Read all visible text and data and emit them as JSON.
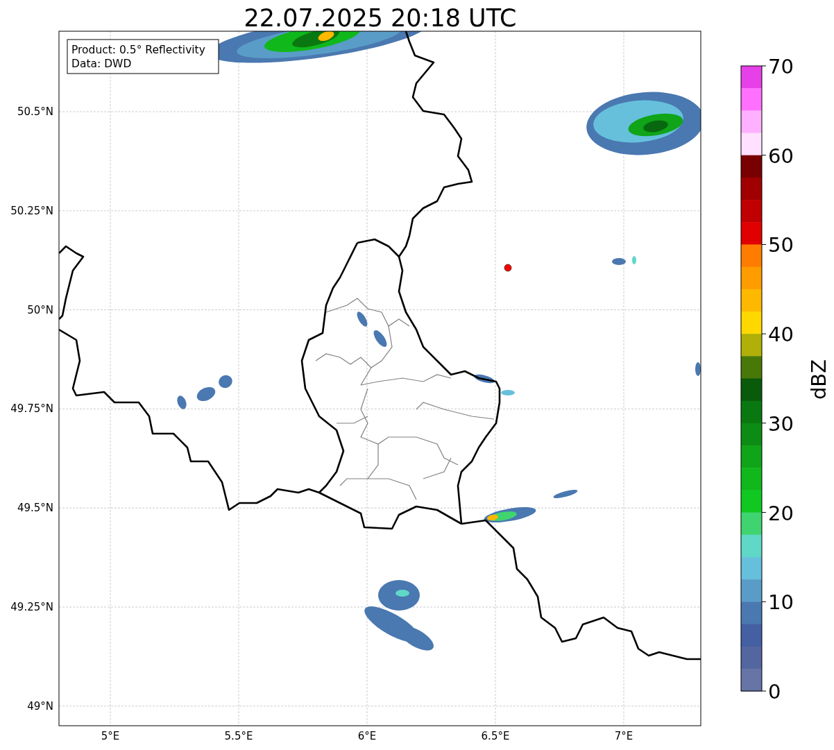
{
  "title": "22.07.2025 20:18 UTC",
  "map": {
    "info_box": [
      "Product: 0.5° Reflectivity",
      "Data: DWD"
    ],
    "lon_ticks": [
      "5°E",
      "5.5°E",
      "6°E",
      "6.5°E",
      "7°E"
    ],
    "lat_ticks": [
      "50.5°N",
      "50.25°N",
      "50°N",
      "49.75°N",
      "49.5°N",
      "49.25°N",
      "49°N"
    ]
  },
  "colorbar": {
    "label": "dBZ",
    "ticks": [
      "70",
      "60",
      "50",
      "40",
      "30",
      "20",
      "10",
      "0"
    ],
    "segments": [
      {
        "color": "#e840e8"
      },
      {
        "color": "#ff70ff"
      },
      {
        "color": "#ffb0ff"
      },
      {
        "color": "#ffe0ff"
      },
      {
        "color": "#780000"
      },
      {
        "color": "#a00000"
      },
      {
        "color": "#c00000"
      },
      {
        "color": "#e00000"
      },
      {
        "color": "#ff7c00"
      },
      {
        "color": "#ff9c00"
      },
      {
        "color": "#ffb800"
      },
      {
        "color": "#ffd800"
      },
      {
        "color": "#b0b008"
      },
      {
        "color": "#487808"
      },
      {
        "color": "#0a5a0c"
      },
      {
        "color": "#0a7810"
      },
      {
        "color": "#0c8c14"
      },
      {
        "color": "#10a418"
      },
      {
        "color": "#10b81c"
      },
      {
        "color": "#10c820"
      },
      {
        "color": "#40d470"
      },
      {
        "color": "#60d8c8"
      },
      {
        "color": "#66c0dc"
      },
      {
        "color": "#5a9cc8"
      },
      {
        "color": "#4a78b0"
      },
      {
        "color": "#4460a2"
      },
      {
        "color": "#5466a0"
      },
      {
        "color": "#6674a6"
      }
    ]
  }
}
